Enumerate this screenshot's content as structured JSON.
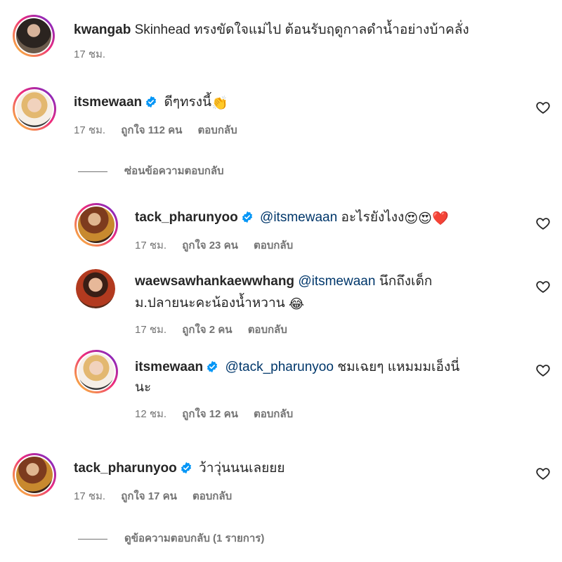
{
  "comments": [
    {
      "username": "kwangab",
      "text": "Skinhead ทรงขัดใจแม่ไป ต้อนรับฤดูกาลดำน้ำอย่างบ้าคลั่ง",
      "time": "17 ชม."
    },
    {
      "username": "itsmewaan",
      "text": "ดีๆทรงนี้",
      "emoji": "👏",
      "time": "17 ชม.",
      "likes": "ถูกใจ 112 คน",
      "reply": "ตอบกลับ",
      "replies_toggle": "ซ่อนข้อความตอบกลับ"
    },
    {
      "username": "tack_pharunyoo",
      "mention": "@itsmewaan",
      "text": "อะไรยังไงง",
      "emoji": "😍😍❤️",
      "time": "17 ชม.",
      "likes": "ถูกใจ 23 คน",
      "reply": "ตอบกลับ"
    },
    {
      "username": "waewsawhankaewwhang",
      "mention": "@itsmewaan",
      "text_line1": "นึกถึงเด็ก",
      "text_line2": "ม.ปลายนะคะน้องน้ำหวาน",
      "emoji": "😂",
      "time": "17 ชม.",
      "likes": "ถูกใจ 2 คน",
      "reply": "ตอบกลับ"
    },
    {
      "username": "itsmewaan",
      "mention": "@tack_pharunyoo",
      "text_line1": "ชมเฉยๆ แหมมมเอ็งนี่",
      "text_line2": "นะ",
      "time": "12 ชม.",
      "likes": "ถูกใจ 12 คน",
      "reply": "ตอบกลับ"
    },
    {
      "username": "tack_pharunyoo",
      "text": "ว้าวุ่นนนเลยยย",
      "time": "17 ชม.",
      "likes": "ถูกใจ 17 คน",
      "reply": "ตอบกลับ",
      "replies_toggle": "ดูข้อความตอบกลับ (1 รายการ)"
    }
  ],
  "colors": {
    "text": "#262626",
    "meta": "#737373",
    "mention": "#00376b",
    "verified": "#0095f6"
  },
  "icons": {
    "verified": "verified-badge-icon",
    "like": "heart-outline-icon"
  }
}
